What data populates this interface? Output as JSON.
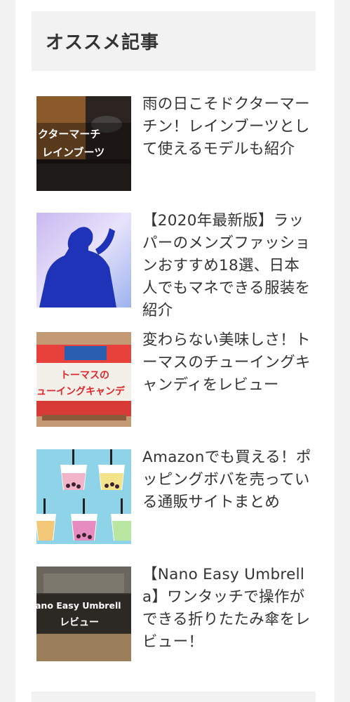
{
  "widget": {
    "title": "オススメ記事"
  },
  "articles": [
    {
      "title": "雨の日こそドクターマーチン！レインブーツとして使えるモデルも紹介",
      "thumb_text": [
        "クターマーチ",
        "レインブーツ"
      ],
      "thumb_icon": "rain-boots-photo-icon"
    },
    {
      "title": "【2020年最新版】ラッパーのメンズファッションおすすめ18選、日本人でもマネできる服装を紹介",
      "thumb_icon": "rapper-silhouette-icon"
    },
    {
      "title": "変わらない美味しさ！トーマスのチューイングキャンディをレビュー",
      "thumb_text": [
        "トーマスの",
        "ューイングキャンデ"
      ],
      "thumb_icon": "candy-package-icon"
    },
    {
      "title": "Amazonでも買える！ポッピングボバを売っている通販サイトまとめ",
      "thumb_icon": "bubble-tea-cups-icon"
    },
    {
      "title": "【Nano Easy Umbrella】ワンタッチで操作ができる折りたたみ傘をレビュー！",
      "thumb_text": [
        "ano Easy Umbrell",
        "レビュー"
      ],
      "thumb_icon": "umbrella-box-photo-icon"
    }
  ],
  "colors": {
    "page_bg": "#f2f2f2",
    "card_bg": "#ffffff",
    "title_bg": "#f2f2f3",
    "text": "#333333"
  }
}
